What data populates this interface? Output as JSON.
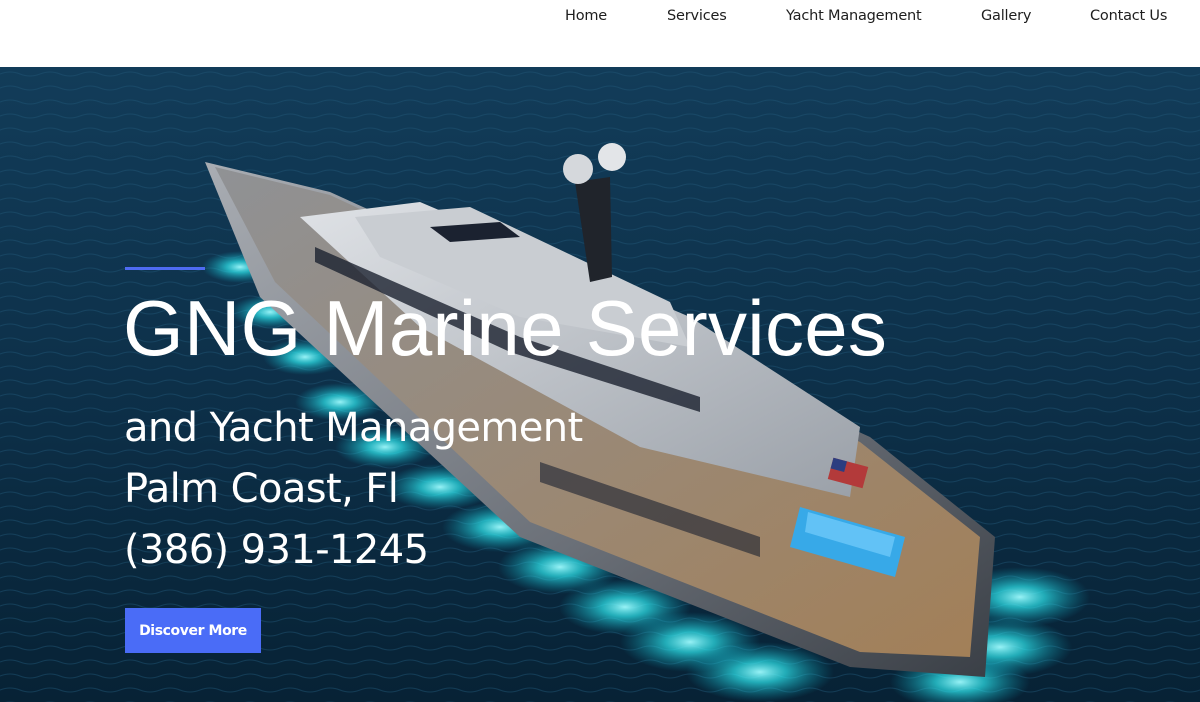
{
  "nav": {
    "items": [
      {
        "label": "Home"
      },
      {
        "label": "Services"
      },
      {
        "label": "Yacht Management"
      },
      {
        "label": "Gallery"
      },
      {
        "label": "Contact Us"
      }
    ]
  },
  "hero": {
    "title": "GNG Marine Services",
    "subtitle_line1": "and Yacht Management",
    "subtitle_line2": "Palm Coast, Fl",
    "phone": "(386) 931-1245",
    "cta_label": "Discover More"
  },
  "colors": {
    "accent": "#4a6cf7",
    "ocean": "#0c2f45",
    "underwater_light": "#3ff0f0"
  },
  "icons": {
    "hero_image": "yacht-photo"
  }
}
